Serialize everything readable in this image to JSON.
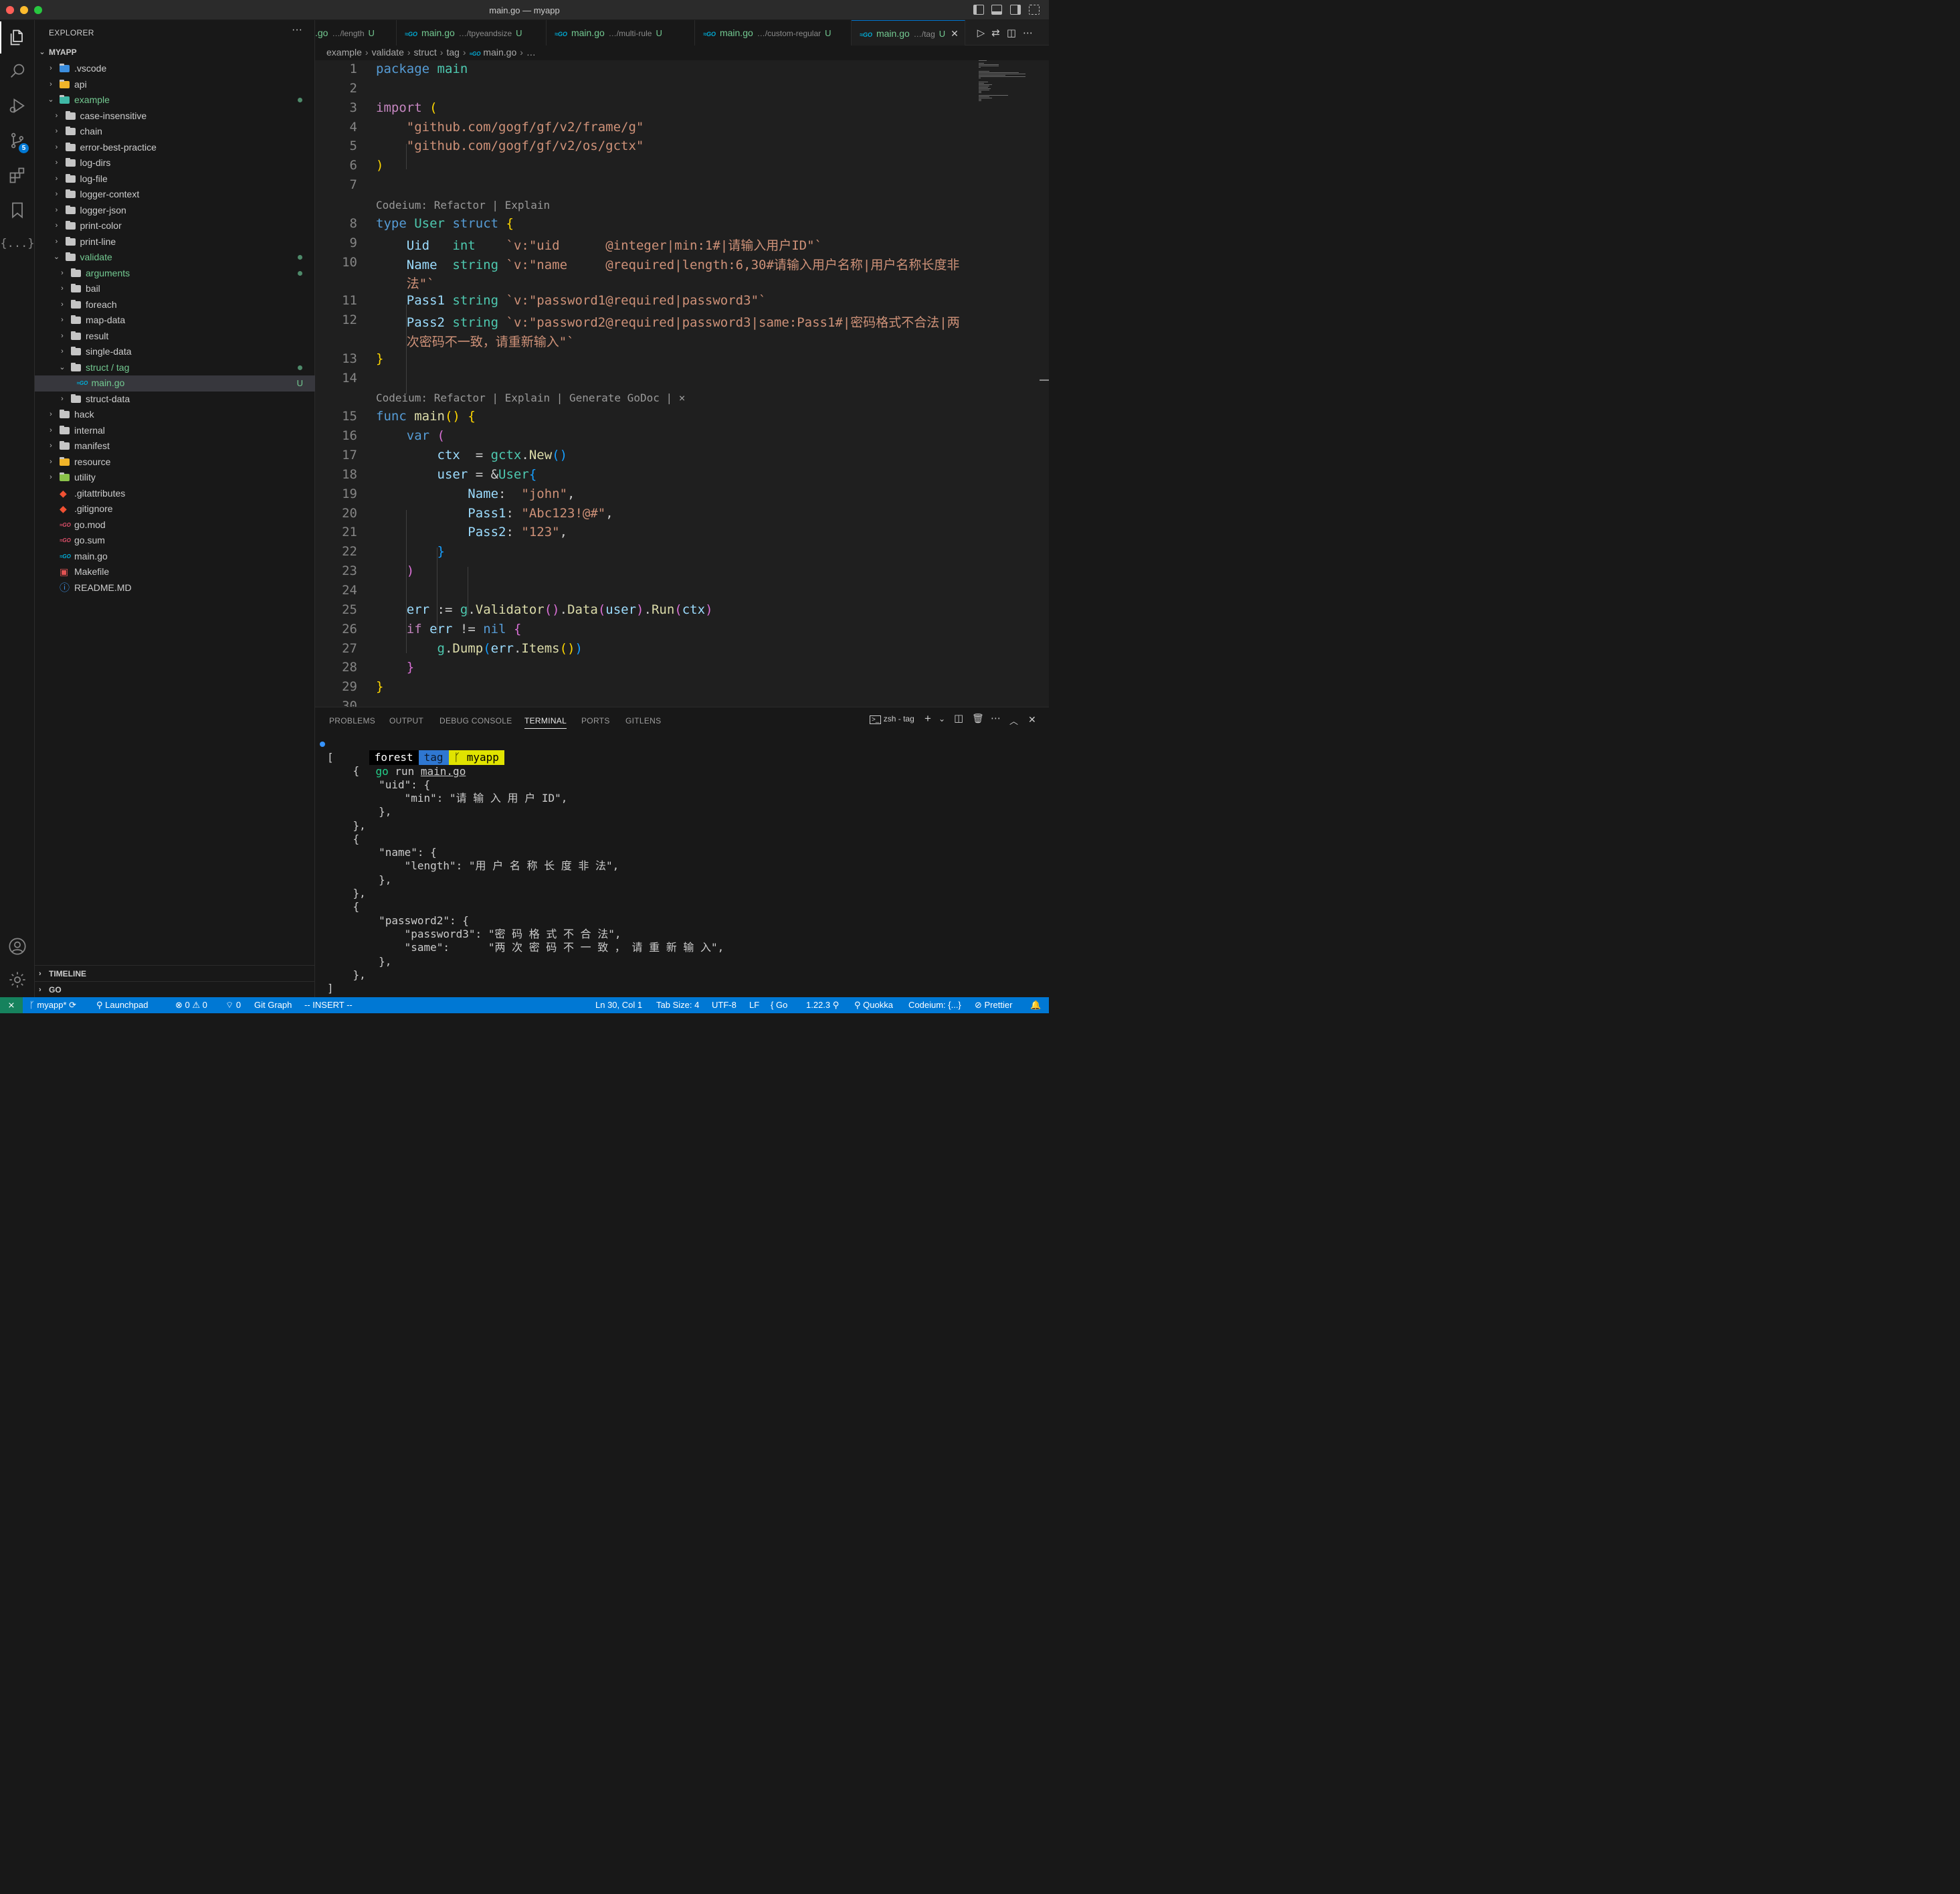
{
  "window": {
    "title": "main.go — myapp"
  },
  "sidebar": {
    "title": "EXPLORER",
    "more_label": "···",
    "root": "MYAPP",
    "tree": [
      {
        "label": ".vscode",
        "depth": 1,
        "kind": "folder-vscode",
        "expanded": false
      },
      {
        "label": "api",
        "depth": 1,
        "kind": "folder-api",
        "expanded": false
      },
      {
        "label": "example",
        "depth": 1,
        "kind": "folder-example",
        "expanded": true,
        "modified": true
      },
      {
        "label": "case-insensitive",
        "depth": 2,
        "kind": "folder",
        "expanded": false
      },
      {
        "label": "chain",
        "depth": 2,
        "kind": "folder",
        "expanded": false
      },
      {
        "label": "error-best-practice",
        "depth": 2,
        "kind": "folder",
        "expanded": false
      },
      {
        "label": "log-dirs",
        "depth": 2,
        "kind": "folder",
        "expanded": false
      },
      {
        "label": "log-file",
        "depth": 2,
        "kind": "folder",
        "expanded": false
      },
      {
        "label": "logger-context",
        "depth": 2,
        "kind": "folder",
        "expanded": false
      },
      {
        "label": "logger-json",
        "depth": 2,
        "kind": "folder",
        "expanded": false
      },
      {
        "label": "print-color",
        "depth": 2,
        "kind": "folder",
        "expanded": false
      },
      {
        "label": "print-line",
        "depth": 2,
        "kind": "folder",
        "expanded": false
      },
      {
        "label": "validate",
        "depth": 2,
        "kind": "folder",
        "expanded": true,
        "modified": true
      },
      {
        "label": "arguments",
        "depth": 3,
        "kind": "folder",
        "expanded": false,
        "modified": true
      },
      {
        "label": "bail",
        "depth": 3,
        "kind": "folder",
        "expanded": false
      },
      {
        "label": "foreach",
        "depth": 3,
        "kind": "folder",
        "expanded": false
      },
      {
        "label": "map-data",
        "depth": 3,
        "kind": "folder",
        "expanded": false
      },
      {
        "label": "result",
        "depth": 3,
        "kind": "folder",
        "expanded": false
      },
      {
        "label": "single-data",
        "depth": 3,
        "kind": "folder",
        "expanded": false
      },
      {
        "label": "struct / tag",
        "depth": 3,
        "kind": "folder",
        "expanded": true,
        "modified": true
      },
      {
        "label": "main.go",
        "depth": 4,
        "kind": "go",
        "selected": true,
        "status": "U"
      },
      {
        "label": "struct-data",
        "depth": 3,
        "kind": "folder",
        "expanded": false
      },
      {
        "label": "hack",
        "depth": 1,
        "kind": "folder",
        "expanded": false
      },
      {
        "label": "internal",
        "depth": 1,
        "kind": "folder",
        "expanded": false
      },
      {
        "label": "manifest",
        "depth": 1,
        "kind": "folder",
        "expanded": false
      },
      {
        "label": "resource",
        "depth": 1,
        "kind": "folder-resource",
        "expanded": false
      },
      {
        "label": "utility",
        "depth": 1,
        "kind": "folder-utility",
        "expanded": false
      },
      {
        "label": ".gitattributes",
        "depth": 1,
        "kind": "git"
      },
      {
        "label": ".gitignore",
        "depth": 1,
        "kind": "git"
      },
      {
        "label": "go.mod",
        "depth": 1,
        "kind": "gomod"
      },
      {
        "label": "go.sum",
        "depth": 1,
        "kind": "gomod"
      },
      {
        "label": "main.go",
        "depth": 1,
        "kind": "go"
      },
      {
        "label": "Makefile",
        "depth": 1,
        "kind": "make"
      },
      {
        "label": "README.MD",
        "depth": 1,
        "kind": "info"
      }
    ],
    "sections": [
      "TIMELINE",
      "GO"
    ]
  },
  "tabs": [
    {
      "name": ".go",
      "path": "…/length",
      "status": "U"
    },
    {
      "name": "main.go",
      "path": "…/tpyeandsize",
      "status": "U"
    },
    {
      "name": "main.go",
      "path": "…/multi-rule",
      "status": "U"
    },
    {
      "name": "main.go",
      "path": "…/custom-regular",
      "status": "U"
    },
    {
      "name": "main.go",
      "path": "…/tag",
      "status": "U",
      "active": true
    }
  ],
  "go_icon_text": "GO",
  "close_glyph": "✕",
  "breadcrumb": [
    "example",
    "validate",
    "struct",
    "tag",
    "main.go",
    "…"
  ],
  "editor": {
    "lines": [
      {
        "n": "1",
        "html": "<span class='kw'>package</span> <span class='ty'>main</span>"
      },
      {
        "n": "2",
        "html": ""
      },
      {
        "n": "3",
        "html": "<span class='kwc'>import</span> <span class='b1'>(</span>"
      },
      {
        "n": "4",
        "html": "    <span class='str'>\"github.com/gogf/gf/v2/frame/g\"</span>"
      },
      {
        "n": "5",
        "html": "    <span class='str'>\"github.com/gogf/gf/v2/os/gctx\"</span>"
      },
      {
        "n": "6",
        "html": "<span class='b1'>)</span>"
      },
      {
        "n": "7",
        "html": ""
      },
      {
        "lens": "Codeium: Refactor | Explain"
      },
      {
        "n": "8",
        "html": "<span class='kw'>type</span> <span class='ty'>User</span> <span class='kw'>struct</span> <span class='b1'>{</span>"
      },
      {
        "n": "9",
        "html": "    <span class='var'>Uid</span>   <span class='ty'>int</span>    <span class='str'>`v:\"uid      @integer|min:1#|请输入用户ID\"`</span>"
      },
      {
        "n": "10",
        "html": "    <span class='var'>Name</span>  <span class='ty'>string</span> <span class='str'>`v:\"name     @required|length:6,30#请输入用户名称|用户名称长度非</span>"
      },
      {
        "n": "",
        "html": "    <span class='str'>法\"`</span>"
      },
      {
        "n": "11",
        "html": "    <span class='var'>Pass1</span> <span class='ty'>string</span> <span class='str'>`v:\"password1@required|password3\"`</span>"
      },
      {
        "n": "12",
        "html": "    <span class='var'>Pass2</span> <span class='ty'>string</span> <span class='str'>`v:\"password2@required|password3|same:Pass1#|密码格式不合法|两</span>"
      },
      {
        "n": "",
        "html": "    <span class='str'>次密码不一致，请重新输入\"`</span>"
      },
      {
        "n": "13",
        "html": "<span class='b1'>}</span>"
      },
      {
        "n": "14",
        "html": ""
      },
      {
        "lens": "Codeium: Refactor | Explain | Generate GoDoc | ×"
      },
      {
        "n": "15",
        "html": "<span class='kw'>func</span> <span class='fn'>main</span><span class='b1'>()</span> <span class='b1'>{</span>"
      },
      {
        "n": "16",
        "html": "    <span class='kw'>var</span> <span class='b2'>(</span>"
      },
      {
        "n": "17",
        "html": "        <span class='var'>ctx</span>  = <span class='pk'>gctx</span>.<span class='fn'>New</span><span class='b3'>()</span>"
      },
      {
        "n": "18",
        "html": "        <span class='var'>user</span> = &amp;<span class='ty'>User</span><span class='b3'>{</span>"
      },
      {
        "n": "19",
        "html": "            <span class='var'>Name</span>:  <span class='str'>\"john\"</span>,"
      },
      {
        "n": "20",
        "html": "            <span class='var'>Pass1</span>: <span class='str'>\"Abc123!@#\"</span>,"
      },
      {
        "n": "21",
        "html": "            <span class='var'>Pass2</span>: <span class='str'>\"123\"</span>,"
      },
      {
        "n": "22",
        "html": "        <span class='b3'>}</span>"
      },
      {
        "n": "23",
        "html": "    <span class='b2'>)</span>"
      },
      {
        "n": "24",
        "html": ""
      },
      {
        "n": "25",
        "html": "    <span class='var'>err</span> := <span class='pk'>g</span>.<span class='fn'>Validator</span><span class='b2'>()</span>.<span class='fn'>Data</span><span class='b2'>(</span><span class='var'>user</span><span class='b2'>)</span>.<span class='fn'>Run</span><span class='b2'>(</span><span class='var'>ctx</span><span class='b2'>)</span>"
      },
      {
        "n": "26",
        "html": "    <span class='kwc'>if</span> <span class='var'>err</span> != <span class='kw'>nil</span> <span class='b2'>{</span>"
      },
      {
        "n": "27",
        "html": "        <span class='pk'>g</span>.<span class='fn'>Dump</span><span class='b3'>(</span><span class='var'>err</span>.<span class='fn'>Items</span><span class='b1'>()</span><span class='b3'>)</span>"
      },
      {
        "n": "28",
        "html": "    <span class='b2'>}</span>"
      },
      {
        "n": "29",
        "html": "<span class='b1'>}</span>"
      },
      {
        "n": "30",
        "html": ""
      }
    ]
  },
  "panel": {
    "tabs": [
      "PROBLEMS",
      "OUTPUT",
      "DEBUG CONSOLE",
      "TERMINAL",
      "PORTS",
      "GITLENS"
    ],
    "active_tab": "TERMINAL",
    "terminal_name": "zsh - tag",
    "prompt": {
      "seg1": "forest",
      "seg2": "tag",
      "seg3": "myapp",
      "command": "go run main.go"
    },
    "output": [
      "[",
      "    {",
      "        \"uid\": {",
      "            \"min\": \"请 输 入 用 户 ID\",",
      "        },",
      "    },",
      "    {",
      "        \"name\": {",
      "            \"length\": \"用 户 名 称 长 度 非 法\",",
      "        },",
      "    },",
      "    {",
      "        \"password2\": {",
      "            \"password3\": \"密 码 格 式 不 合 法\",",
      "            \"same\":      \"两 次 密 码 不 一 致 ， 请 重 新 输 入\",",
      "        },",
      "    },",
      "]"
    ]
  },
  "statusbar": {
    "branch": "myapp*",
    "launchpad": "Launchpad",
    "errors": "0",
    "warnings": "0",
    "ports": "0",
    "git_graph": "Git Graph",
    "mode": "-- INSERT --",
    "position": "Ln 30, Col 1",
    "tab_size": "Tab Size: 4",
    "encoding": "UTF-8",
    "eol": "LF",
    "language": "Go",
    "go_version": "1.22.3",
    "quokka": "Quokka",
    "codeium": "Codeium: {...}",
    "prettier": "Prettier"
  },
  "colors": {
    "accent": "#0078d4",
    "status_bar": "#0078d4",
    "git_untracked": "#73c991"
  }
}
